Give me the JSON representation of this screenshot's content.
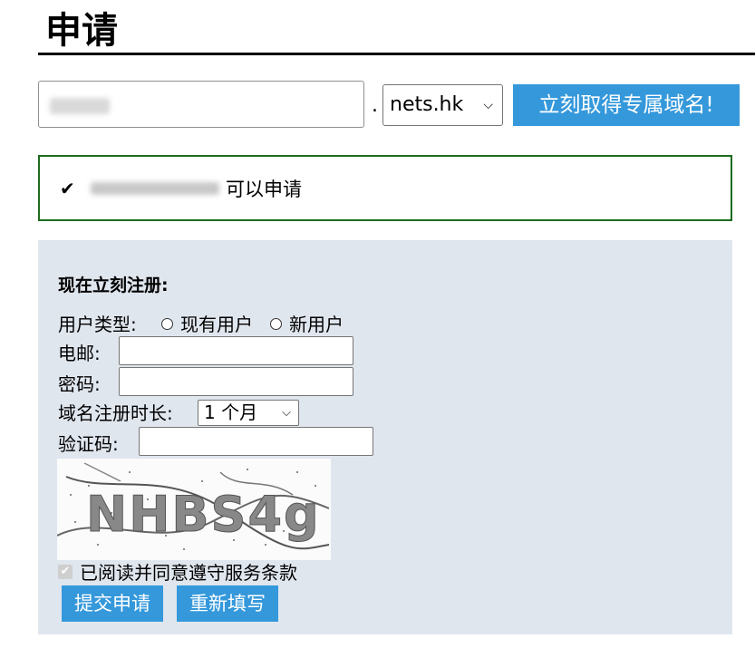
{
  "page": {
    "title": "申请"
  },
  "domain_form": {
    "dot": ".",
    "tld_selected": "nets.hk",
    "submit_label": "立刻取得专属域名!"
  },
  "availability": {
    "check_mark": "✔",
    "message": "可以申请"
  },
  "register": {
    "title": "现在立刻注册:",
    "user_type_label": "用户类型:",
    "user_type_options": [
      "现有用户",
      "新用户"
    ],
    "email_label": "电邮:",
    "password_label": "密码:",
    "duration_label": "域名注册时长:",
    "duration_selected": "1 个月",
    "captcha_label": "验证码:",
    "captcha_text": "NHBS4g",
    "agree_label": "已阅读并同意遵守服务条款",
    "submit_label": "提交申请",
    "reset_label": "重新填写"
  },
  "colors": {
    "accent": "#3498db",
    "success_border": "#1e6b1e",
    "panel_bg": "#e0e6ee"
  }
}
